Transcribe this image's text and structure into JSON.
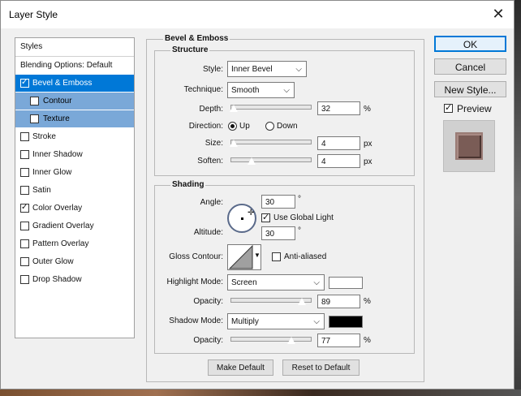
{
  "window": {
    "title": "Layer Style",
    "close_glyph": "✕"
  },
  "styles_list": {
    "header": "Styles",
    "items": [
      {
        "label": "Blending Options: Default",
        "checkbox": false,
        "checked": false
      },
      {
        "label": "Bevel & Emboss",
        "checkbox": true,
        "checked": true
      },
      {
        "label": "Contour",
        "checkbox": true,
        "checked": false
      },
      {
        "label": "Texture",
        "checkbox": true,
        "checked": false
      },
      {
        "label": "Stroke",
        "checkbox": true,
        "checked": false
      },
      {
        "label": "Inner Shadow",
        "checkbox": true,
        "checked": false
      },
      {
        "label": "Inner Glow",
        "checkbox": true,
        "checked": false
      },
      {
        "label": "Satin",
        "checkbox": true,
        "checked": false
      },
      {
        "label": "Color Overlay",
        "checkbox": true,
        "checked": true
      },
      {
        "label": "Gradient Overlay",
        "checkbox": true,
        "checked": false
      },
      {
        "label": "Pattern Overlay",
        "checkbox": true,
        "checked": false
      },
      {
        "label": "Outer Glow",
        "checkbox": true,
        "checked": false
      },
      {
        "label": "Drop Shadow",
        "checkbox": true,
        "checked": false
      }
    ]
  },
  "bevel": {
    "title": "Bevel & Emboss",
    "structure": {
      "title": "Structure",
      "style_label": "Style:",
      "style_value": "Inner Bevel",
      "technique_label": "Technique:",
      "technique_value": "Smooth",
      "depth_label": "Depth:",
      "depth_value": "32",
      "depth_unit": "%",
      "direction_label": "Direction:",
      "direction_up": "Up",
      "direction_down": "Down",
      "size_label": "Size:",
      "size_value": "4",
      "size_unit": "px",
      "soften_label": "Soften:",
      "soften_value": "4",
      "soften_unit": "px"
    },
    "shading": {
      "title": "Shading",
      "angle_label": "Angle:",
      "angle_value": "30",
      "angle_unit": "°",
      "use_global_light": "Use Global Light",
      "altitude_label": "Altitude:",
      "altitude_value": "30",
      "altitude_unit": "°",
      "gloss_contour_label": "Gloss Contour:",
      "anti_aliased": "Anti-aliased",
      "highlight_mode_label": "Highlight Mode:",
      "highlight_mode_value": "Screen",
      "highlight_opacity_label": "Opacity:",
      "highlight_opacity_value": "89",
      "highlight_opacity_unit": "%",
      "shadow_mode_label": "Shadow Mode:",
      "shadow_mode_value": "Multiply",
      "shadow_opacity_label": "Opacity:",
      "shadow_opacity_value": "77",
      "shadow_opacity_unit": "%",
      "highlight_color": "#ffffff",
      "shadow_color": "#000000"
    },
    "make_default": "Make Default",
    "reset_default": "Reset to Default"
  },
  "buttons": {
    "ok": "OK",
    "cancel": "Cancel",
    "new_style": "New Style...",
    "preview": "Preview"
  },
  "colors": {
    "selection": "#0078d7",
    "sub_selection": "#7aa8d8",
    "preview_swatch": "#7a5c56"
  }
}
